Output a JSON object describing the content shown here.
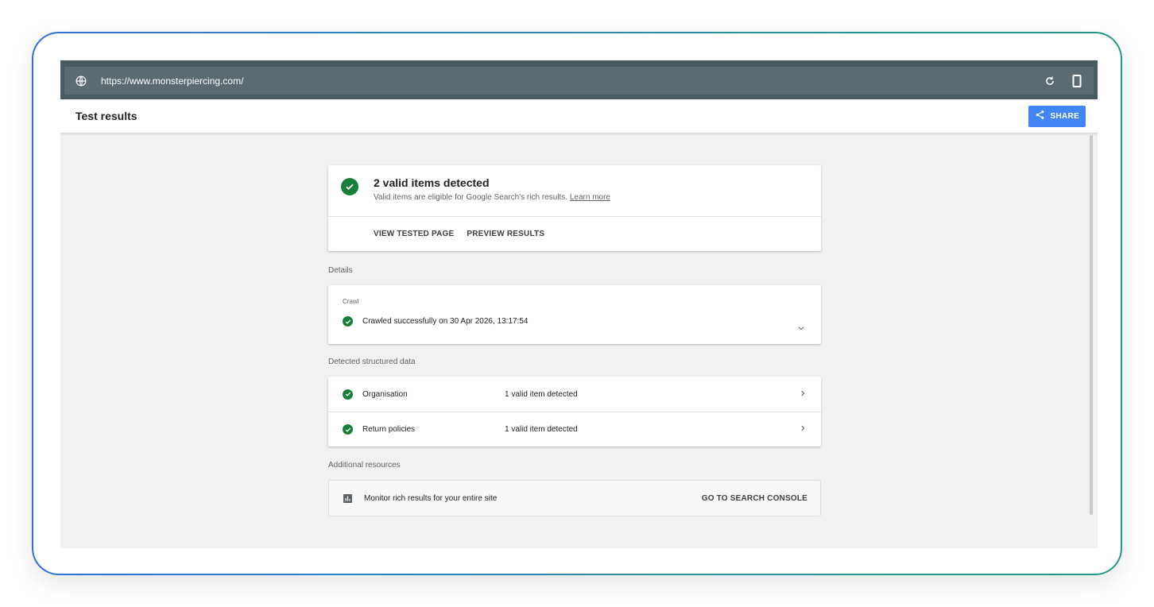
{
  "browser": {
    "url": "https://www.monsterpiercing.com/",
    "icons": {
      "site": "globe-icon",
      "reload": "reload-icon",
      "device": "mobile-device-icon"
    }
  },
  "header": {
    "title": "Test results",
    "share_label": "SHARE",
    "share_icon": "share-icon"
  },
  "summary": {
    "title": "2 valid items detected",
    "subtitle": "Valid items are eligible for Google Search's rich results.",
    "learn_more": "Learn more",
    "actions": [
      "VIEW TESTED PAGE",
      "PREVIEW RESULTS"
    ]
  },
  "details": {
    "label": "Details",
    "crawl_label": "Crawl",
    "crawl_status": "Crawled successfully on 30 Apr 2026, 13:17:54"
  },
  "structured_data": {
    "label": "Detected structured data",
    "items": [
      {
        "name": "Organisation",
        "status": "1 valid item detected"
      },
      {
        "name": "Return policies",
        "status": "1 valid item detected"
      }
    ]
  },
  "resources": {
    "label": "Additional resources",
    "text": "Monitor rich results for your entire site",
    "action": "GO TO SEARCH CONSOLE"
  },
  "colors": {
    "accent": "#4285f4",
    "success": "#188038",
    "toolbar": "#4a5a62"
  }
}
